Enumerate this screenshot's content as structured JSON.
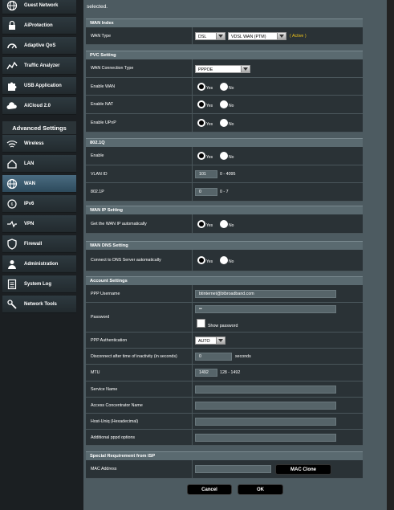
{
  "sidebar": {
    "items_top": [
      {
        "label": "Guest Network",
        "icon": "globe-icon"
      },
      {
        "label": "AiProtection",
        "icon": "lock-icon"
      },
      {
        "label": "Adaptive QoS",
        "icon": "gauge-icon"
      },
      {
        "label": "Traffic Analyzer",
        "icon": "chart-icon"
      },
      {
        "label": "USB Application",
        "icon": "puzzle-icon"
      },
      {
        "label": "AiCloud 2.0",
        "icon": "cloud-icon"
      }
    ],
    "advanced_header": "Advanced Settings",
    "items_advanced": [
      {
        "label": "Wireless",
        "icon": "wifi-icon"
      },
      {
        "label": "LAN",
        "icon": "home-icon"
      },
      {
        "label": "WAN",
        "icon": "globe-icon"
      },
      {
        "label": "IPv6",
        "icon": "ipv6-icon"
      },
      {
        "label": "VPN",
        "icon": "vpn-icon"
      },
      {
        "label": "Firewall",
        "icon": "shield-icon"
      },
      {
        "label": "Administration",
        "icon": "user-icon"
      },
      {
        "label": "System Log",
        "icon": "log-icon"
      },
      {
        "label": "Network Tools",
        "icon": "tools-icon"
      }
    ],
    "active_item": "WAN"
  },
  "intro_text": "selected.",
  "wan_index": {
    "header": "WAN Index",
    "wan_type_label": "WAN Type",
    "wan_type_value": "DSL",
    "wan_subtype_value": "VDSL WAN (PTM)",
    "status": "( Active )"
  },
  "pvc": {
    "header": "PVC Setting",
    "connection_type_label": "WAN Connection Type",
    "connection_type_value": "PPPOE",
    "enable_wan_label": "Enable WAN",
    "enable_nat_label": "Enable NAT",
    "enable_upnp_label": "Enable UPnP"
  },
  "radio": {
    "yes": "Yes",
    "no": "No"
  },
  "dot1q": {
    "header": "802.1Q",
    "enable_label": "Enable",
    "vlan_id_label": "VLAN ID",
    "vlan_id_value": "101",
    "vlan_id_range": "0 - 4095",
    "p_label": "802.1P",
    "p_value": "0",
    "p_range": "0 - 7"
  },
  "wan_ip": {
    "header": "WAN IP Setting",
    "auto_label": "Get the WAN IP automatically"
  },
  "wan_dns": {
    "header": "WAN DNS Setting",
    "auto_label": "Connect to DNS Server automatically"
  },
  "account": {
    "header": "Account Settings",
    "username_label": "PPP Username",
    "username_value": "btinternet@btbroadband.com",
    "password_label": "Password",
    "password_value": "••",
    "show_password": "Show password",
    "auth_label": "PPP Authentication",
    "auth_value": "AUTO",
    "disconnect_label": "Disconnect after time of inactivity (in seconds)",
    "disconnect_value": "0",
    "disconnect_unit": "seconds",
    "mtu_label": "MTU",
    "mtu_value": "1492",
    "mtu_range": "128 - 1492",
    "service_label": "Service Name",
    "service_value": "",
    "concentrator_label": "Access Concentrator Name",
    "concentrator_value": "",
    "host_uniq_label": "Host-Uniq (Hexadecimal)",
    "host_uniq_value": "",
    "pppd_label": "Additional pppd options",
    "pppd_value": ""
  },
  "special": {
    "header": "Special Requirement from ISP",
    "mac_label": "MAC Address",
    "mac_value": "",
    "mac_clone": "MAC Clone"
  },
  "buttons": {
    "cancel": "Cancel",
    "ok": "OK"
  }
}
